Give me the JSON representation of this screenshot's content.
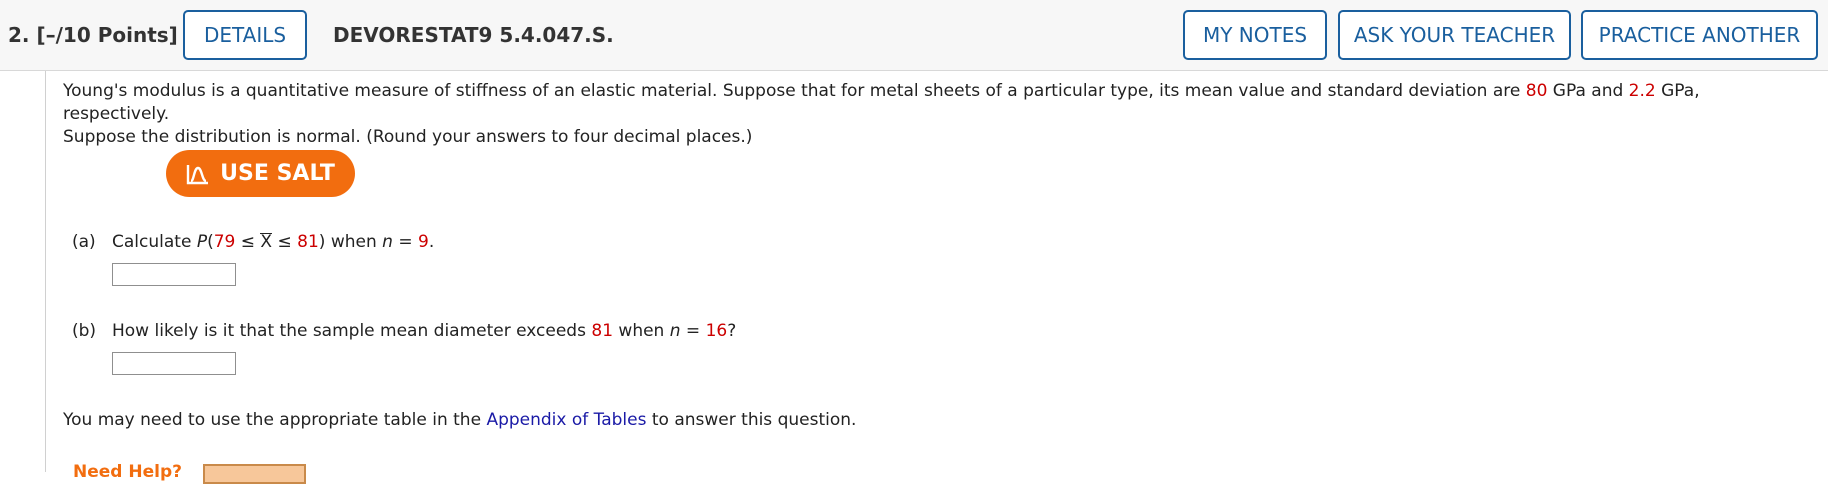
{
  "header": {
    "question_number": "2.  [–/10 Points]",
    "details_label": "DETAILS",
    "question_code": "DEVORESTAT9 5.4.047.S.",
    "my_notes_label": "MY NOTES",
    "ask_teacher_label": "ASK YOUR TEACHER",
    "practice_another_label": "PRACTICE ANOTHER"
  },
  "problem": {
    "line1_a": "Young's modulus is a quantitative measure of stiffness of an elastic material. Suppose that for metal sheets of a particular type, its mean value and standard deviation are ",
    "mean": "80",
    "line1_b": " GPa and ",
    "sd": "2.2",
    "line1_c": " GPa, respectively.",
    "line2": "Suppose the distribution is normal. (Round your answers to four decimal places.)"
  },
  "salt": {
    "label": "USE SALT",
    "icon": "salt-graph-icon"
  },
  "part_a": {
    "label": "(a)",
    "text_a": "Calculate ",
    "p": "P",
    "open": "(",
    "lower": "79",
    "le1": " ≤ ",
    "xbar": "X",
    "le2": " ≤ ",
    "upper": "81",
    "close": ")",
    "when": " when ",
    "n_sym": "n",
    "eq": " = ",
    "n_val": "9",
    "period": "."
  },
  "part_b": {
    "label": "(b)",
    "text_a": "How likely is it that the sample mean diameter exceeds ",
    "threshold": "81",
    "when": " when ",
    "n_sym": "n",
    "eq": " = ",
    "n_val": "16",
    "qmark": "?"
  },
  "footer": {
    "text_a": "You may need to use the appropriate table in the ",
    "link": "Appendix of Tables",
    "text_b": " to answer this question."
  },
  "need_help": {
    "label": "Need Help?"
  },
  "colors": {
    "accent": "#1a5f9e",
    "salt": "#f26d0f",
    "value_red": "#cc0000",
    "link": "#1a1aa6"
  }
}
